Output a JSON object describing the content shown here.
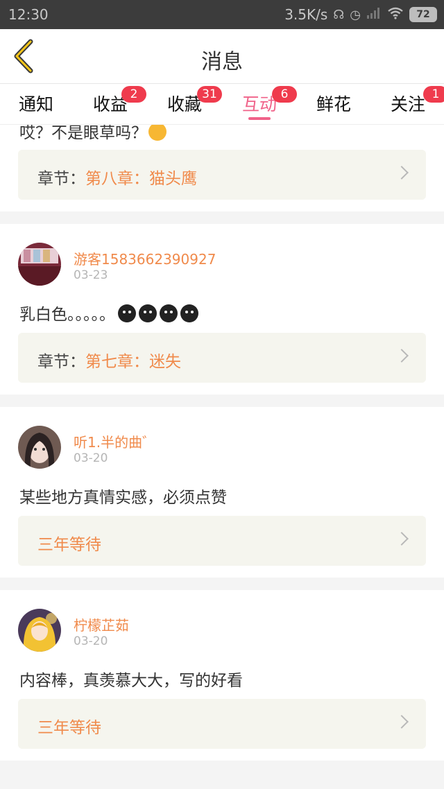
{
  "status_bar": {
    "time": "12:30",
    "network_speed": "3.5K/s",
    "battery": "72"
  },
  "header": {
    "title": "消息",
    "back_icon": "chevron-left-icon"
  },
  "tabs": [
    {
      "label": "通知",
      "badge": ""
    },
    {
      "label": "收益",
      "badge": "2"
    },
    {
      "label": "收藏",
      "badge": "31"
    },
    {
      "label": "互动",
      "badge": "6",
      "active": true
    },
    {
      "label": "鲜花",
      "badge": ""
    },
    {
      "label": "关注",
      "badge": "1"
    }
  ],
  "colors": {
    "accent": "#f06289",
    "badge": "#ef3b4d",
    "username": "#f08a4b",
    "chapter_bg": "#f5f5ee"
  },
  "messages": [
    {
      "comment": "哎？不是眼草吗？",
      "chapter_prefix": "章节：",
      "chapter_name": "第八章：猫头鹰"
    },
    {
      "username": "游客1583662390927",
      "date": "03-23",
      "comment": "乳白色。。。。。",
      "chapter_prefix": "章节：",
      "chapter_name": "第七章：迷失"
    },
    {
      "username": "听1.半的曲゛",
      "date": "03-20",
      "comment": "某些地方真情实感，必须点赞",
      "chapter_name": "三年等待"
    },
    {
      "username": "柠檬芷茹",
      "date": "03-20",
      "comment": "内容棒，真羡慕大大，写的好看",
      "chapter_name": "三年等待"
    }
  ]
}
